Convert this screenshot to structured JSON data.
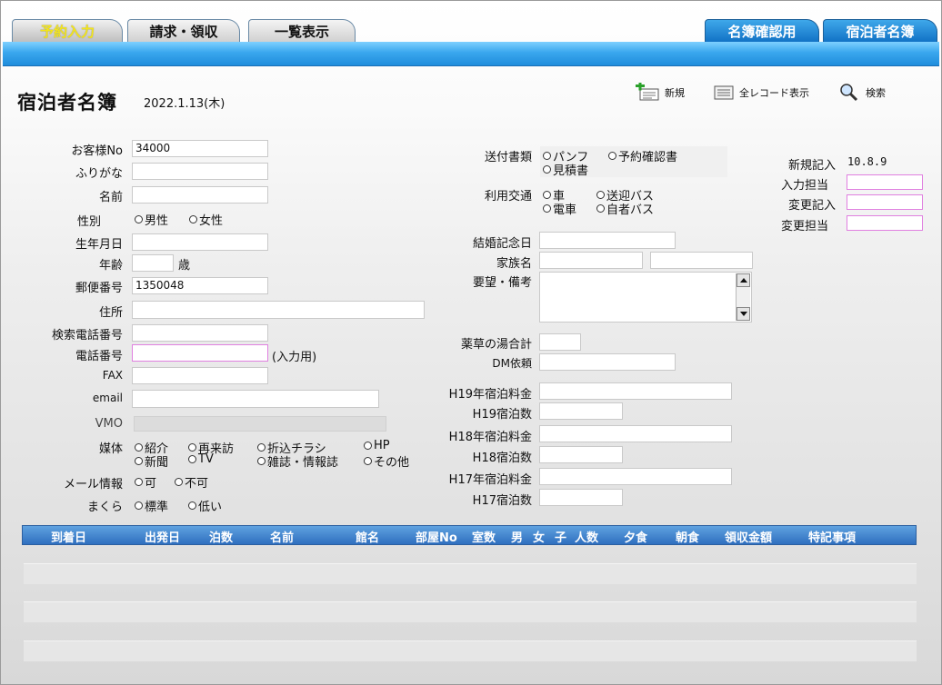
{
  "tabs": {
    "left": [
      {
        "label": "予約入力",
        "active": true
      },
      {
        "label": "請求・領収",
        "active": false
      },
      {
        "label": "一覧表示",
        "active": false
      }
    ],
    "right": [
      {
        "label": "名簿確認用"
      },
      {
        "label": "宿泊者名簿"
      }
    ]
  },
  "header": {
    "title": "宿泊者名簿",
    "date": "2022.1.13(木)"
  },
  "toolbar": {
    "new_label": "新規",
    "all_records_label": "全レコード表示",
    "search_label": "検索"
  },
  "form": {
    "customer_no": {
      "label": "お客様No",
      "value": "34000"
    },
    "furigana": {
      "label": "ふりがな",
      "value": ""
    },
    "name": {
      "label": "名前",
      "value": ""
    },
    "gender": {
      "label": "性別",
      "options": [
        "男性",
        "女性"
      ]
    },
    "birthdate": {
      "label": "生年月日",
      "value": ""
    },
    "age": {
      "label": "年齢",
      "value": "",
      "unit": "歳"
    },
    "postal_code": {
      "label": "郵便番号",
      "value": "1350048"
    },
    "address": {
      "label": "住所",
      "value": ""
    },
    "search_phone": {
      "label": "検索電話番号",
      "value": ""
    },
    "phone": {
      "label": "電話番号",
      "value": "",
      "note": "(入力用)"
    },
    "fax": {
      "label": "FAX",
      "value": ""
    },
    "email": {
      "label": "email",
      "value": ""
    },
    "vmo": {
      "label": "VMO",
      "value": ""
    },
    "media": {
      "label": "媒体",
      "options": [
        "紹介",
        "再来訪",
        "折込チラシ",
        "HP",
        "新聞",
        "TV",
        "雑誌・情報誌",
        "その他"
      ]
    },
    "mail_info": {
      "label": "メール情報",
      "options": [
        "可",
        "不可"
      ]
    },
    "pillow": {
      "label": "まくら",
      "options": [
        "標準",
        "低い"
      ]
    },
    "documents": {
      "label": "送付書類",
      "options": [
        "パンフ",
        "予約確認書",
        "見積書"
      ]
    },
    "transport": {
      "label": "利用交通",
      "options": [
        "車",
        "送迎バス",
        "電車",
        "自者バス"
      ]
    },
    "anniversary": {
      "label": "結婚記念日",
      "value": ""
    },
    "family_name": {
      "label": "家族名",
      "value1": "",
      "value2": ""
    },
    "requests": {
      "label": "要望・備考",
      "value": ""
    },
    "herbal_bath": {
      "label": "薬草の湯合計",
      "value": ""
    },
    "dm_request": {
      "label": "DM依頼",
      "value": ""
    },
    "h19_fee": {
      "label": "H19年宿泊料金",
      "value": ""
    },
    "h19_nights": {
      "label": "H19宿泊数",
      "value": ""
    },
    "h18_fee": {
      "label": "H18年宿泊料金",
      "value": ""
    },
    "h18_nights": {
      "label": "H18宿泊数",
      "value": ""
    },
    "h17_fee": {
      "label": "H17年宿泊料金",
      "value": ""
    },
    "h17_nights": {
      "label": "H17宿泊数",
      "value": ""
    },
    "new_entry": {
      "label": "新規記入",
      "value": "10.8.9"
    },
    "entry_staff": {
      "label": "入力担当",
      "value": ""
    },
    "change_entry": {
      "label": "変更記入",
      "value": ""
    },
    "change_staff": {
      "label": "変更担当",
      "value": ""
    }
  },
  "table": {
    "columns": [
      "到着日",
      "出発日",
      "泊数",
      "名前",
      "館名",
      "部屋No",
      "室数",
      "男",
      "女",
      "子",
      "人数",
      "夕食",
      "朝食",
      "領収金額",
      "特記事項"
    ],
    "rows": []
  }
}
